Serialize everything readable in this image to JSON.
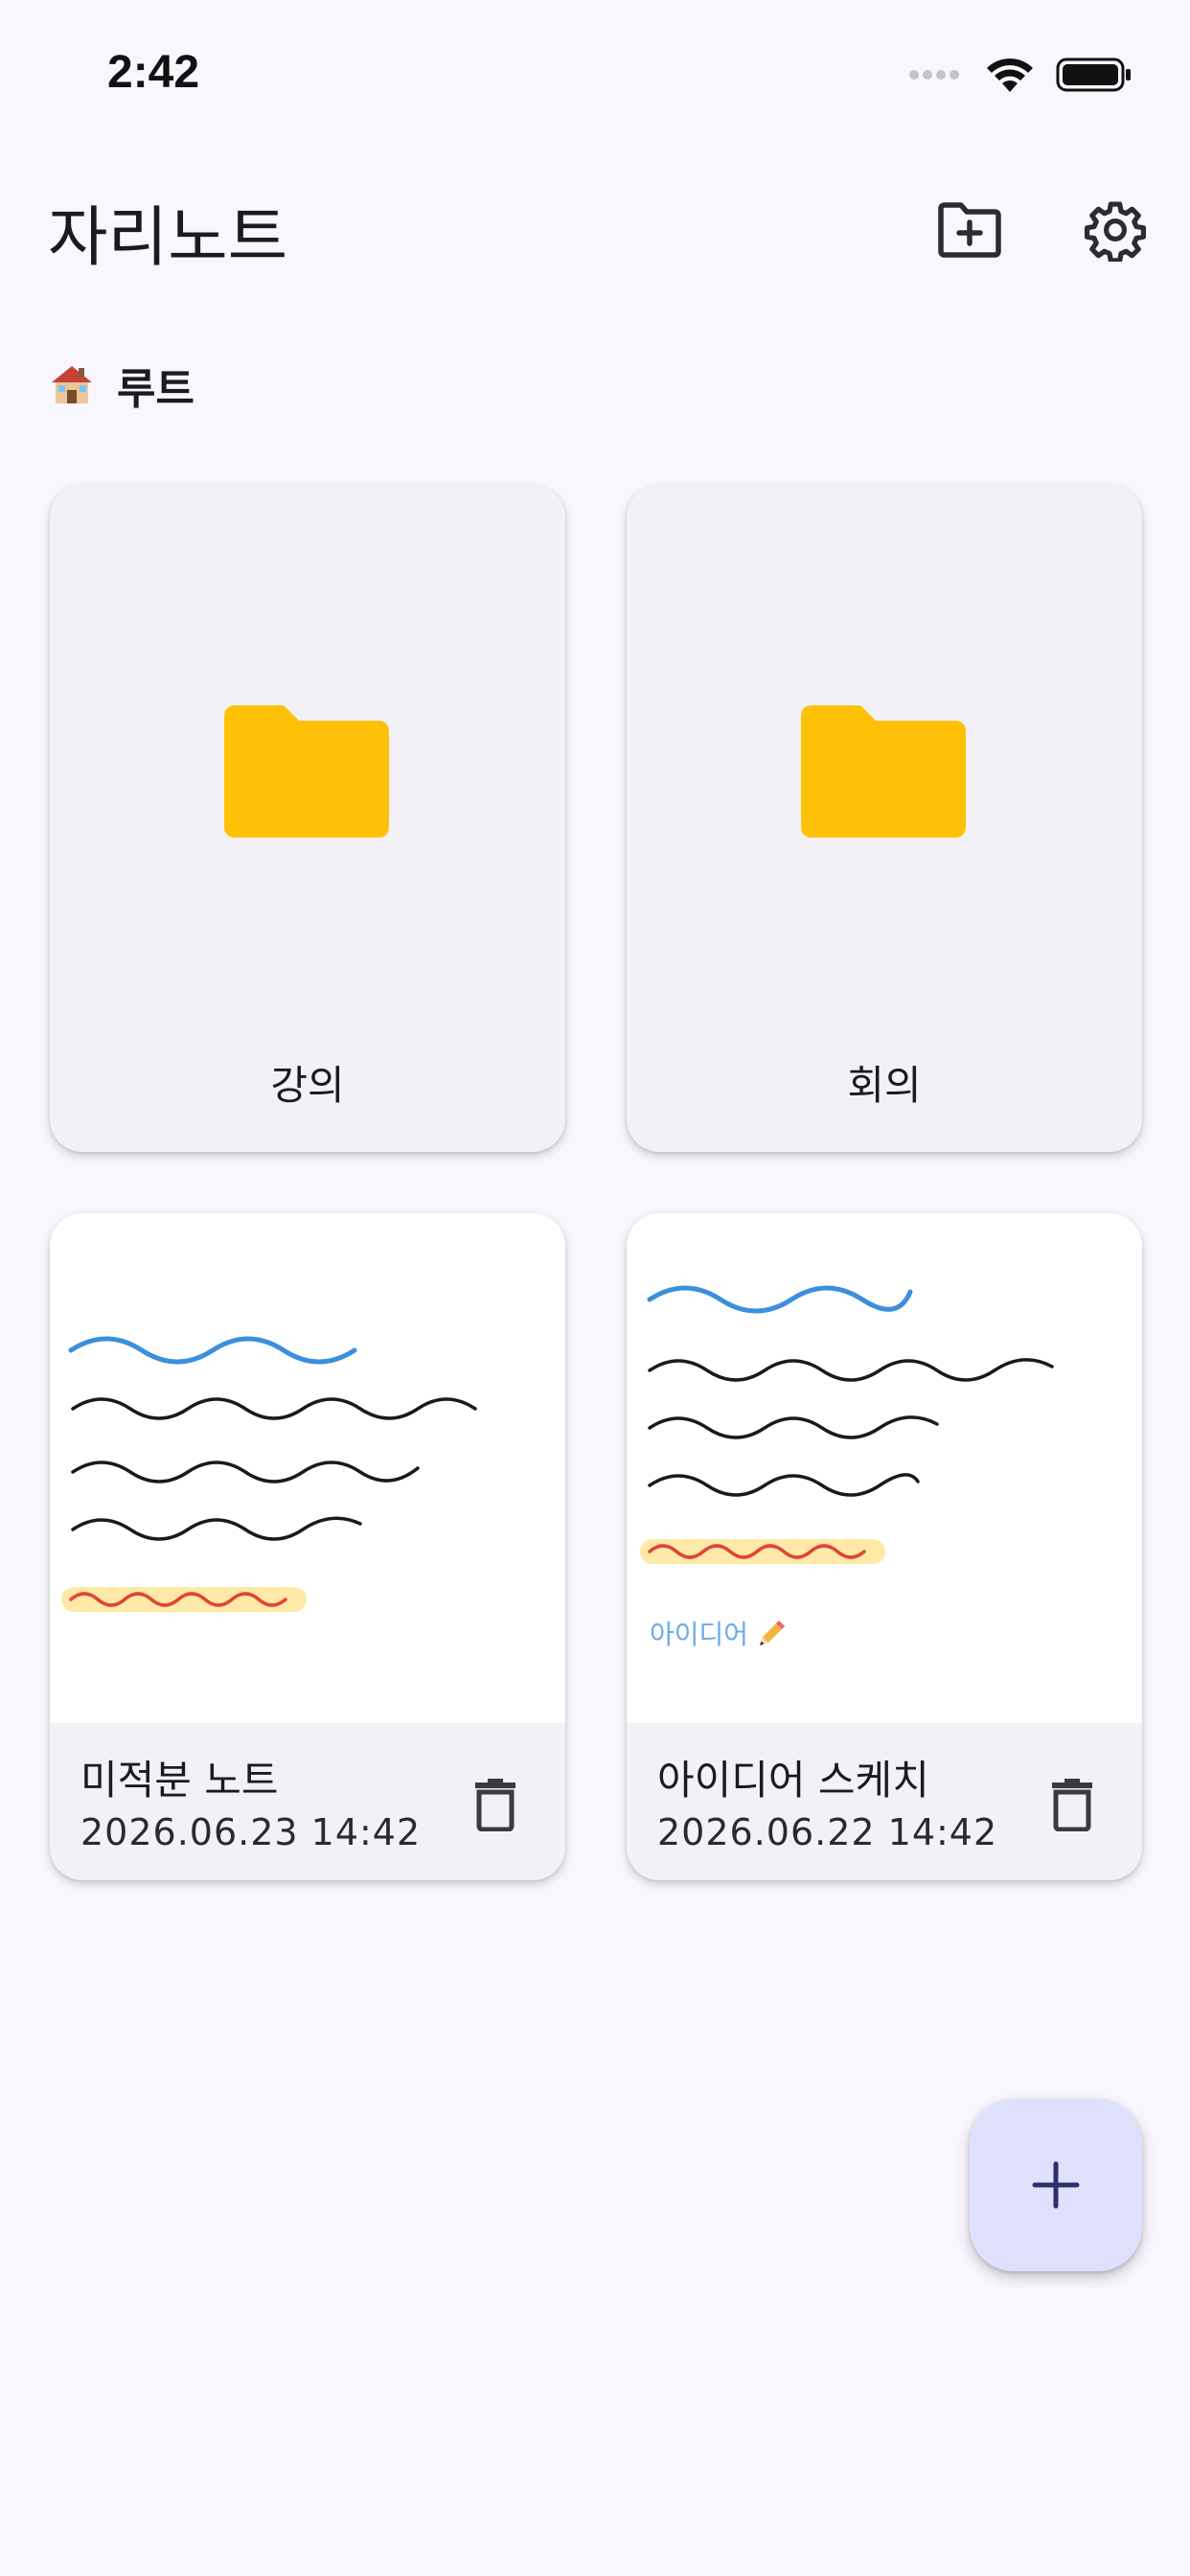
{
  "status_bar": {
    "time": "2:42"
  },
  "app_bar": {
    "title": "자리노트"
  },
  "breadcrumb": {
    "icon": "house-icon",
    "label": "루트"
  },
  "folders": [
    {
      "name": "강의",
      "icon": "folder-icon",
      "color": "#FFC107"
    },
    {
      "name": "회의",
      "icon": "folder-icon",
      "color": "#FFC107"
    }
  ],
  "notes": [
    {
      "title": "미적분 노트",
      "date": "2026.06.23 14:42"
    },
    {
      "title": "아이디어 스케치",
      "date": "2026.06.22 14:42",
      "thumb_text": "아이디어"
    }
  ],
  "colors": {
    "background": "#f9f7fd",
    "card": "#f3f1f6",
    "fab": "#dfe0fb",
    "pen_blue": "#3b8fdc",
    "pen_black": "#1a1a1a",
    "pen_red": "#e0443a",
    "highlight": "#ffe9a6"
  }
}
